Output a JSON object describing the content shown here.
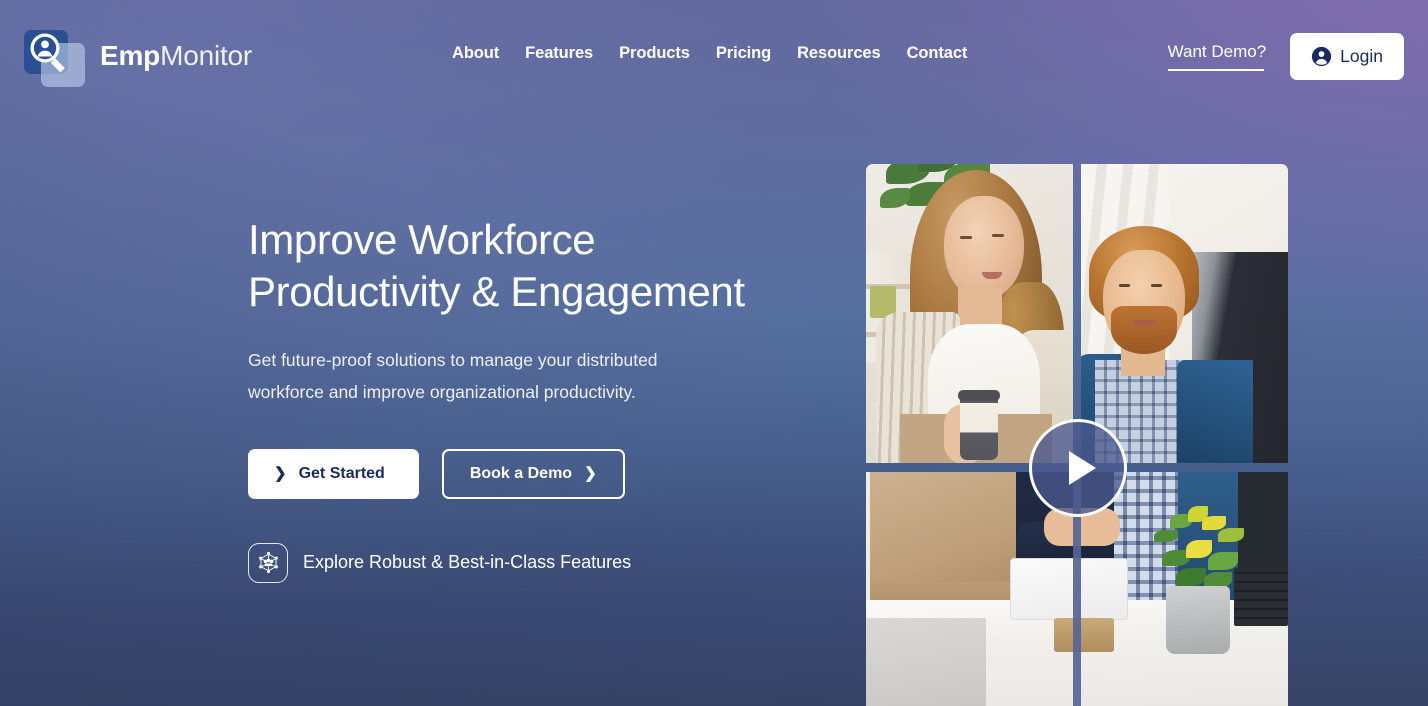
{
  "brand": {
    "name_bold": "Emp",
    "name_light": "Monitor",
    "logo_icon": "magnifier-person-icon"
  },
  "nav": {
    "items": [
      {
        "label": "About"
      },
      {
        "label": "Features"
      },
      {
        "label": "Products"
      },
      {
        "label": "Pricing"
      },
      {
        "label": "Resources"
      },
      {
        "label": "Contact"
      }
    ]
  },
  "header_right": {
    "want_demo_label": "Want Demo?",
    "login_label": "Login",
    "login_icon": "user-circle-icon"
  },
  "hero": {
    "headline": "Improve Workforce\nProductivity & Engagement",
    "subheading": "Get future-proof solutions to manage your distributed\nworkforce and improve organizational productivity.",
    "primary_cta": {
      "label": "Get Started",
      "chevron": "❯"
    },
    "secondary_cta": {
      "label": "Book a Demo",
      "chevron": "❯"
    },
    "explore": {
      "label": "Explore Robust & Best-in-Class Features",
      "icon": "network-hub-icon"
    }
  },
  "media": {
    "play_button_icon": "play-icon",
    "tiles": [
      {
        "name": "woman-with-coffee-in-office"
      },
      {
        "name": "man-looking-at-monitor"
      },
      {
        "name": "team-at-desk-with-tablet-and-plant"
      }
    ]
  },
  "colors": {
    "bg_top_left": "#5f6899",
    "bg_top_right": "#896fb4",
    "bg_bottom": "#374566",
    "accent_navy": "#1b2a5e",
    "white": "#ffffff",
    "logo_blue": "#2b4f93"
  }
}
